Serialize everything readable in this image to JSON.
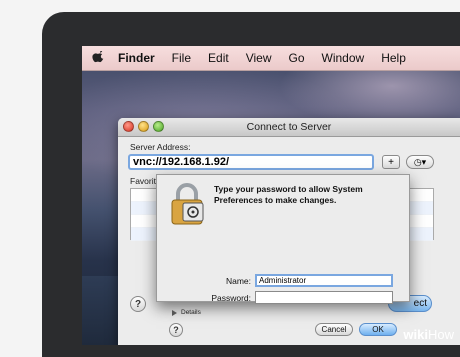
{
  "menubar": {
    "icon": "apple-icon",
    "items": [
      "Finder",
      "File",
      "Edit",
      "View",
      "Go",
      "Window",
      "Help"
    ]
  },
  "connect_window": {
    "title": "Connect to Server",
    "server_address_label": "Server Address:",
    "server_address_value": "vnc://192.168.1.92/",
    "add_button_label": "+",
    "recent_button_icon": "clock-icon",
    "favorites_label": "Favorit",
    "connect_button_label": "ect",
    "help_label": "?"
  },
  "auth_sheet": {
    "icon": "lock-icon",
    "message": "Type your password to allow System Preferences to make changes.",
    "name_label": "Name:",
    "name_value": "Administrator",
    "password_label": "Password:",
    "password_value": "",
    "details_label": "Details",
    "help_label": "?",
    "cancel_label": "Cancel",
    "ok_label": "OK"
  },
  "watermark": {
    "bold": "wiki",
    "light": "How"
  },
  "colors": {
    "focus_ring": "#7aa7e0",
    "default_button": "#6fb0ef"
  }
}
